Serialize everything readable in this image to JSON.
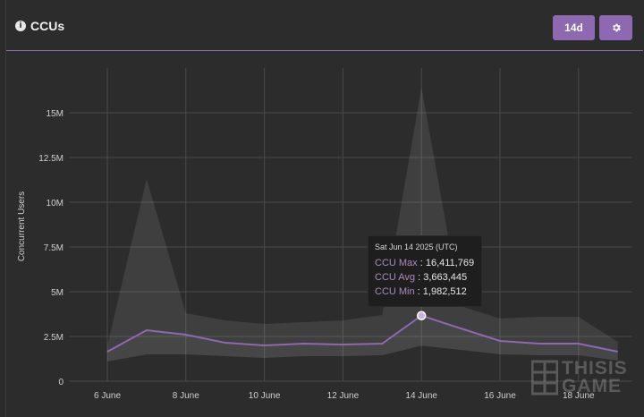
{
  "header": {
    "title": "CCUs",
    "info_icon": "info-icon",
    "range_button": "14d",
    "settings_icon": "gear-icon",
    "accent": "#8e68b0"
  },
  "tooltip": {
    "date": "Sat Jun 14 2025 (UTC)",
    "rows": [
      {
        "label": "CCU Max",
        "value": "16,411,769"
      },
      {
        "label": "CCU Avg",
        "value": "3,663,445"
      },
      {
        "label": "CCU Min",
        "value": "1,982,512"
      }
    ]
  },
  "watermark": {
    "line1": "THISIS",
    "line2": "GAME"
  },
  "chart_data": {
    "type": "line",
    "ylabel": "Concurrent Users",
    "x_ticks": [
      "6 June",
      "8 June",
      "10 June",
      "12 June",
      "14 June",
      "16 June",
      "18 June"
    ],
    "y_ticks": [
      "0",
      "2.5M",
      "5M",
      "7.5M",
      "10M",
      "12.5M",
      "15M"
    ],
    "y_tick_values": [
      0,
      2500000,
      5000000,
      7500000,
      10000000,
      12500000,
      15000000
    ],
    "ylim": [
      0,
      17500000
    ],
    "x_dates": [
      "2025-06-06",
      "2025-06-07",
      "2025-06-08",
      "2025-06-09",
      "2025-06-10",
      "2025-06-11",
      "2025-06-12",
      "2025-06-13",
      "2025-06-14",
      "2025-06-15",
      "2025-06-16",
      "2025-06-17",
      "2025-06-18",
      "2025-06-19"
    ],
    "grid": true,
    "series": [
      {
        "name": "CCU Max",
        "values": [
          2000000,
          11300000,
          3800000,
          3400000,
          3200000,
          3300000,
          3400000,
          3700000,
          16411769,
          4200000,
          3500000,
          3600000,
          3600000,
          2200000
        ]
      },
      {
        "name": "CCU Avg",
        "values": [
          1650000,
          2850000,
          2600000,
          2150000,
          2000000,
          2100000,
          2050000,
          2100000,
          3663445,
          2950000,
          2250000,
          2100000,
          2100000,
          1650000
        ]
      },
      {
        "name": "CCU Min",
        "values": [
          1100000,
          1500000,
          1500000,
          1400000,
          1300000,
          1400000,
          1400000,
          1450000,
          1982512,
          1750000,
          1500000,
          1450000,
          1450000,
          1150000
        ]
      }
    ],
    "highlighted_date": "2025-06-14",
    "colors": {
      "line": "#8e68b0",
      "band": "#4a4a4a",
      "grid": "#4a4a4a",
      "axis": "#cfcfcf"
    }
  }
}
